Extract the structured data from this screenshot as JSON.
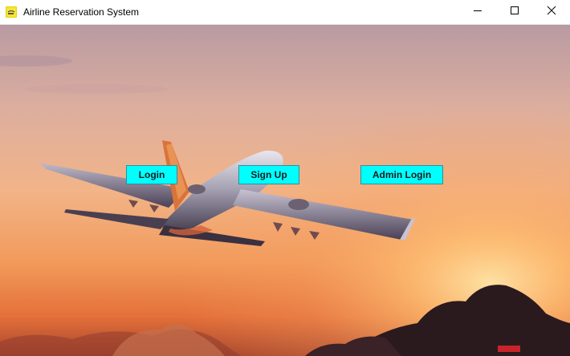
{
  "window": {
    "title": "Airline Reservation System",
    "icon": "java-cup-icon",
    "controls": {
      "minimize_icon": "minimize-icon",
      "maximize_icon": "maximize-icon",
      "close_icon": "close-icon"
    }
  },
  "background": {
    "description_icon": "airplane-sunset-background",
    "sky_top_color": "#c9a4a3",
    "sky_glow_color": "#ffbf73",
    "horizon_color": "#e8632a"
  },
  "buttons": {
    "login_label": "Login",
    "signup_label": "Sign Up",
    "admin_login_label": "Admin Login",
    "button_color": "#00ffff"
  }
}
